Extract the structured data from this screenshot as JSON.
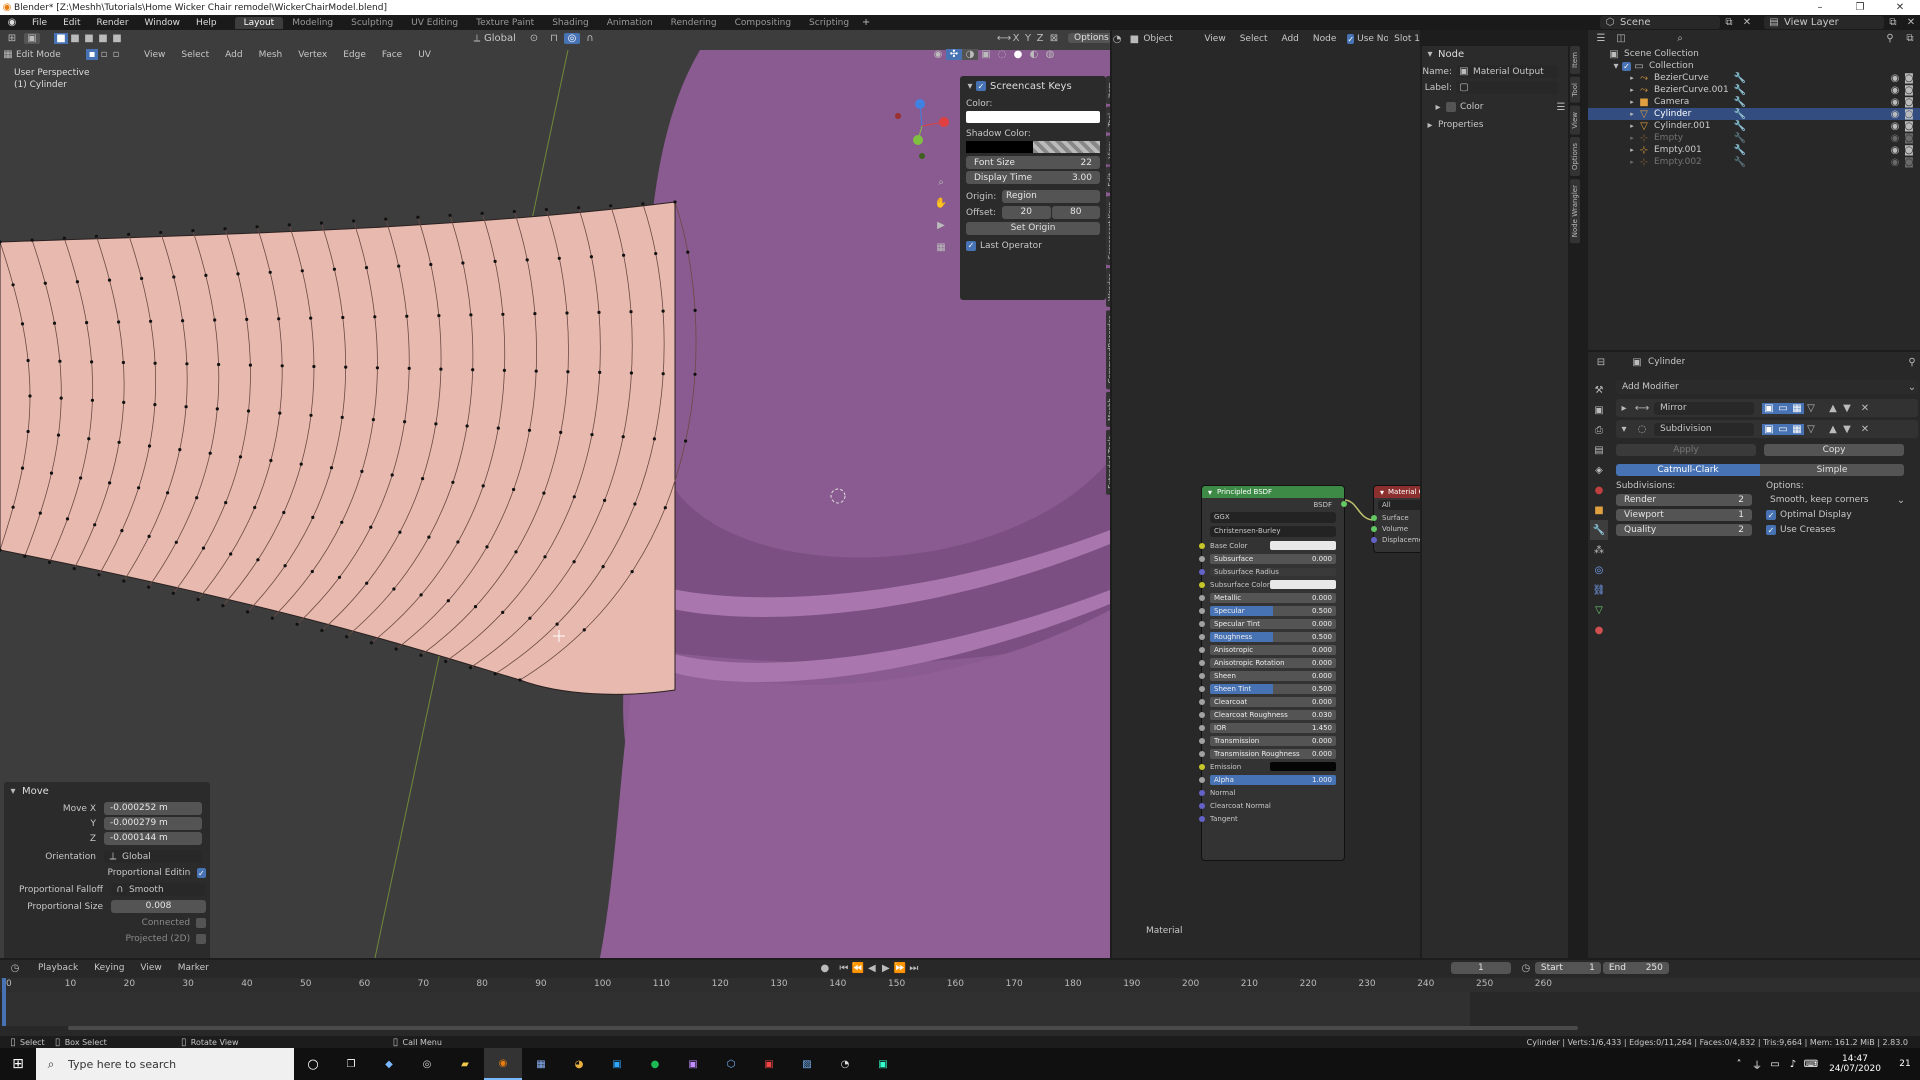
{
  "titlebar": {
    "title": "Blender* [Z:\\Meshh\\Tutorials\\Home Wicker Chair remodel\\WickerChairModel.blend]",
    "minimize": "–",
    "maximize": "❐",
    "close": "✕"
  },
  "topbar": {
    "menus": [
      "File",
      "Edit",
      "Render",
      "Window",
      "Help"
    ],
    "workspaces": [
      "Layout",
      "Modeling",
      "Sculpting",
      "UV Editing",
      "Texture Paint",
      "Shading",
      "Animation",
      "Rendering",
      "Compositing",
      "Scripting"
    ],
    "active_workspace": "Layout",
    "add_tab": "+",
    "scene": "Scene",
    "view_layer": "View Layer"
  },
  "viewport": {
    "mode": "Edit Mode",
    "menus": [
      "View",
      "Select",
      "Add",
      "Mesh",
      "Vertex",
      "Edge",
      "Face",
      "UV"
    ],
    "transform": "Global",
    "options": "Options",
    "axes": [
      "X",
      "Y",
      "Z"
    ],
    "perspective": "User Perspective",
    "object": "(1) Cylinder"
  },
  "screencast": {
    "title": "Screencast Keys",
    "color_label": "Color:",
    "shadow_label": "Shadow Color:",
    "font_size_label": "Font Size",
    "font_size": "22",
    "display_time_label": "Display Time",
    "display_time": "3.00",
    "origin_label": "Origin:",
    "origin": "Region",
    "offset_label": "Offset:",
    "offset_x": "20",
    "offset_y": "80",
    "set_origin": "Set Origin",
    "last_operator": "Last Operator"
  },
  "sidetabs": [
    "Item",
    "Tool",
    "View",
    "Edit",
    "Screencast Keys",
    "Wender",
    "CommandRecorder",
    "Meshh",
    "Extended Tools"
  ],
  "move_panel": {
    "title": "Move",
    "move_x_label": "Move X",
    "move_x": "-0.000252 m",
    "y_label": "Y",
    "y": "-0.000279 m",
    "z_label": "Z",
    "z": "-0.000144 m",
    "orientation_label": "Orientation",
    "orientation": "Global",
    "prop_edit": "Proportional Editing",
    "falloff_label": "Proportional Falloff",
    "falloff": "Smooth",
    "size_label": "Proportional Size",
    "size": "0.008",
    "connected": "Connected",
    "projected": "Projected (2D)"
  },
  "node_editor": {
    "object": "Object",
    "menus": [
      "View",
      "Select",
      "Add",
      "Node"
    ],
    "use_nodes": "Use Nodes",
    "slot": "Slot 1",
    "material": "Material",
    "footer": "Material"
  },
  "node_panel": {
    "title": "Node",
    "name_label": "Name:",
    "name": "Material Output",
    "label_label": "Label:",
    "color": "Color",
    "properties": "Properties"
  },
  "node_tabs": [
    "Item",
    "Tool",
    "View",
    "Options",
    "Node Wrangler"
  ],
  "bsdf": {
    "title": "Principled BSDF",
    "out": "BSDF",
    "dist": "GGX",
    "sss": "Christensen-Burley",
    "inputs": [
      {
        "label": "Base Color",
        "value": "",
        "kind": "color"
      },
      {
        "label": "Subsurface",
        "value": "0.000",
        "kind": "num"
      },
      {
        "label": "Subsurface Radius",
        "value": "",
        "kind": "vec"
      },
      {
        "label": "Subsurface Color",
        "value": "",
        "kind": "color"
      },
      {
        "label": "Metallic",
        "value": "0.000",
        "kind": "num"
      },
      {
        "label": "Specular",
        "value": "0.500",
        "kind": "bar",
        "fill": 0.5
      },
      {
        "label": "Specular Tint",
        "value": "0.000",
        "kind": "num"
      },
      {
        "label": "Roughness",
        "value": "0.500",
        "kind": "bar",
        "fill": 0.5
      },
      {
        "label": "Anisotropic",
        "value": "0.000",
        "kind": "num"
      },
      {
        "label": "Anisotropic Rotation",
        "value": "0.000",
        "kind": "num"
      },
      {
        "label": "Sheen",
        "value": "0.000",
        "kind": "num"
      },
      {
        "label": "Sheen Tint",
        "value": "0.500",
        "kind": "bar",
        "fill": 0.5
      },
      {
        "label": "Clearcoat",
        "value": "0.000",
        "kind": "num"
      },
      {
        "label": "Clearcoat Roughness",
        "value": "0.030",
        "kind": "num"
      },
      {
        "label": "IOR",
        "value": "1.450",
        "kind": "num"
      },
      {
        "label": "Transmission",
        "value": "0.000",
        "kind": "num"
      },
      {
        "label": "Transmission Roughness",
        "value": "0.000",
        "kind": "num"
      },
      {
        "label": "Emission",
        "value": "",
        "kind": "dark"
      },
      {
        "label": "Alpha",
        "value": "1.000",
        "kind": "bar",
        "fill": 1.0
      },
      {
        "label": "Normal",
        "value": "",
        "kind": "plain"
      },
      {
        "label": "Clearcoat Normal",
        "value": "",
        "kind": "plain"
      },
      {
        "label": "Tangent",
        "value": "",
        "kind": "plain"
      }
    ]
  },
  "matout": {
    "title": "Material Ou",
    "target": "All",
    "inputs": [
      "Surface",
      "Volume",
      "Displacement"
    ]
  },
  "outliner": {
    "root": "Scene Collection",
    "collection": "Collection",
    "items": [
      {
        "name": "BezierCurve",
        "icon": "curve-icon",
        "selected": false,
        "dim": false
      },
      {
        "name": "BezierCurve.001",
        "icon": "curve-icon",
        "selected": false,
        "dim": false
      },
      {
        "name": "Camera",
        "icon": "camera-icon",
        "selected": false,
        "dim": false
      },
      {
        "name": "Cylinder",
        "icon": "mesh-icon",
        "selected": true,
        "dim": false
      },
      {
        "name": "Cylinder.001",
        "icon": "mesh-icon",
        "selected": false,
        "dim": false
      },
      {
        "name": "Empty",
        "icon": "empty-icon",
        "selected": false,
        "dim": true
      },
      {
        "name": "Empty.001",
        "icon": "empty-icon",
        "selected": false,
        "dim": false
      },
      {
        "name": "Empty.002",
        "icon": "empty-icon",
        "selected": false,
        "dim": true
      }
    ]
  },
  "properties": {
    "object": "Cylinder",
    "add_modifier": "Add Modifier",
    "mod1": "Mirror",
    "mod2": "Subdivision",
    "apply": "Apply",
    "copy": "Copy",
    "catmull": "Catmull-Clark",
    "simple": "Simple",
    "subdivisions_label": "Subdivisions:",
    "options_label": "Options:",
    "render_label": "Render",
    "render": "2",
    "viewport_label": "Viewport",
    "viewport": "1",
    "quality_label": "Quality",
    "quality": "2",
    "uv_smooth": "Smooth, keep corners",
    "optimal_display": "Optimal Display",
    "use_creases": "Use Creases"
  },
  "timeline": {
    "menus": [
      "Playback",
      "Keying",
      "View",
      "Marker"
    ],
    "frame": "1",
    "start_label": "Start",
    "start": "1",
    "end_label": "End",
    "end": "250",
    "ticks": [
      "0",
      "10",
      "20",
      "30",
      "40",
      "50",
      "60",
      "70",
      "80",
      "90",
      "100",
      "110",
      "120",
      "130",
      "140",
      "150",
      "160",
      "170",
      "180",
      "190",
      "200",
      "210",
      "220",
      "230",
      "240",
      "250",
      "260"
    ]
  },
  "statusbar": {
    "select": "Select",
    "box_select": "Box Select",
    "rotate_view": "Rotate View",
    "call_menu": "Call Menu",
    "stats": "Cylinder | Verts:1/6,433 | Edges:0/11,264 | Faces:0/4,832 | Tris:9,664 | Mem: 161.2 MiB | 2.83.0"
  },
  "taskbar": {
    "search": "Type here to search",
    "time": "14:47",
    "date": "24/07/2020",
    "notif": "21"
  },
  "colors": {
    "accent": "#4772b3",
    "selected_row": "#334d80",
    "bsdf_header": "#3d8a47",
    "output_header": "#8c2f2f",
    "mesh": "#e8b9ae",
    "object": "#8e5e94"
  }
}
